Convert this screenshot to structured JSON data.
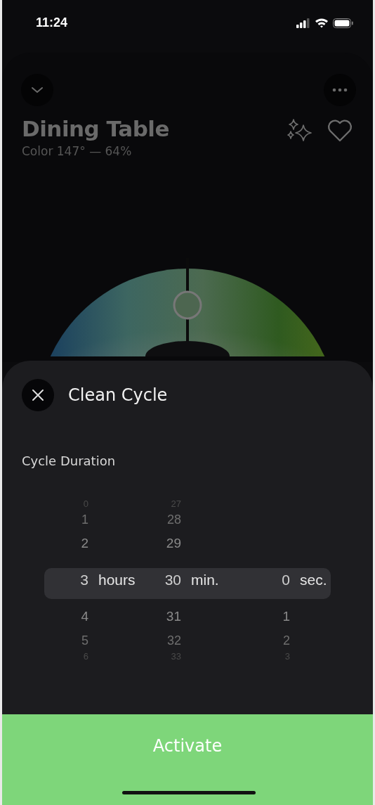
{
  "status_bar": {
    "time": "11:24"
  },
  "light": {
    "title": "Dining Table",
    "subtitle": "Color 147° — 64%",
    "favorite": false
  },
  "sheet": {
    "title": "Clean Cycle",
    "section_label": "Cycle Duration",
    "picker": [
      {
        "unit": "hours",
        "items": [
          {
            "value": "0",
            "selected": false
          },
          {
            "value": "1",
            "selected": false
          },
          {
            "value": "2",
            "selected": false
          },
          {
            "value": "3",
            "selected": true
          },
          {
            "value": "4",
            "selected": false
          },
          {
            "value": "5",
            "selected": false
          },
          {
            "value": "6",
            "selected": false
          }
        ]
      },
      {
        "unit": "min.",
        "items": [
          {
            "value": "27",
            "selected": false
          },
          {
            "value": "28",
            "selected": false
          },
          {
            "value": "29",
            "selected": false
          },
          {
            "value": "30",
            "selected": true
          },
          {
            "value": "31",
            "selected": false
          },
          {
            "value": "32",
            "selected": false
          },
          {
            "value": "33",
            "selected": false
          }
        ]
      },
      {
        "unit": "sec.",
        "items": [
          {
            "value": "0",
            "selected": true
          },
          {
            "value": "1",
            "selected": false
          },
          {
            "value": "2",
            "selected": false
          },
          {
            "value": "3",
            "selected": false
          }
        ]
      }
    ],
    "action": "Activate"
  }
}
